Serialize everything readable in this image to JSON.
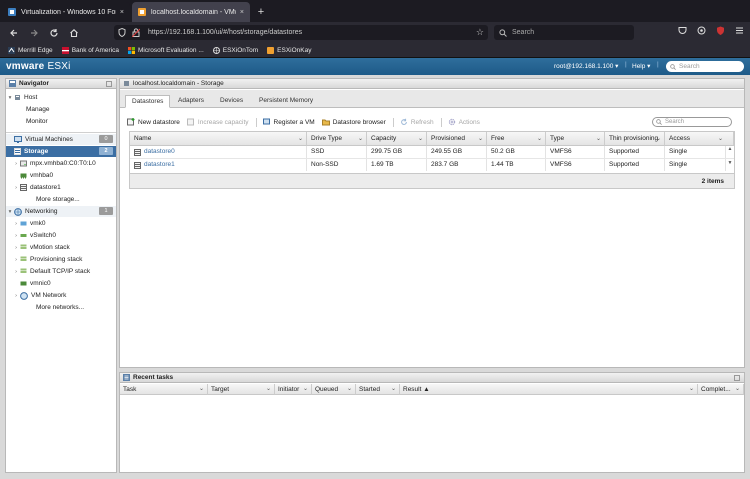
{
  "browser": {
    "tabs": [
      {
        "title": "Virtualization - Windows 10 For",
        "close": "×",
        "active": false
      },
      {
        "title": "localhost.localdomain - VMwa",
        "close": "×",
        "active": true
      }
    ],
    "new_tab": "+",
    "url": "https://192.168.1.100/ui/#/host/storage/datastores",
    "search_placeholder": "Search",
    "bookmarks": [
      "Merrill Edge",
      "Bank of America",
      "Microsoft Evaluation ...",
      "ESXiOnTom",
      "ESXiOnKay"
    ]
  },
  "esxi": {
    "brand": "vmware",
    "product": "ESXi",
    "user": "root@192.168.1.100 ▾",
    "help": "Help ▾",
    "search_placeholder": "Search"
  },
  "navigator": {
    "title": "Navigator",
    "host": {
      "label": "Host",
      "children": [
        "Manage",
        "Monitor"
      ]
    },
    "vms": {
      "label": "Virtual Machines",
      "count": "0"
    },
    "storage": {
      "label": "Storage",
      "count": "2",
      "children": [
        "mpx.vmhba0:C0:T0:L0",
        "vmhba0",
        "datastore1",
        "More storage..."
      ]
    },
    "networking": {
      "label": "Networking",
      "count": "1",
      "children": [
        "vmk0",
        "vSwitch0",
        "vMotion stack",
        "Provisioning stack",
        "Default TCP/IP stack",
        "vmnic0",
        "VM Network",
        "More networks..."
      ]
    }
  },
  "main": {
    "title": "localhost.localdomain - Storage",
    "tabs": [
      "Datastores",
      "Adapters",
      "Devices",
      "Persistent Memory"
    ],
    "toolbar": {
      "new_datastore": "New datastore",
      "increase_capacity": "Increase capacity",
      "register_vm": "Register a VM",
      "datastore_browser": "Datastore browser",
      "refresh": "Refresh",
      "actions": "Actions"
    },
    "search_placeholder": "Search",
    "columns": [
      "Name",
      "Drive Type",
      "Capacity",
      "Provisioned",
      "Free",
      "Type",
      "Thin provisioning",
      "Access"
    ],
    "rows": [
      [
        "datastore0",
        "SSD",
        "299.75 GB",
        "249.55 GB",
        "50.2 GB",
        "VMFS6",
        "Supported",
        "Single"
      ],
      [
        "datastore1",
        "Non-SSD",
        "1.69 TB",
        "283.7 GB",
        "1.44 TB",
        "VMFS6",
        "Supported",
        "Single"
      ]
    ],
    "footer": "2 items"
  },
  "recent_tasks": {
    "title": "Recent tasks",
    "columns": [
      "Task",
      "Target",
      "Initiator",
      "Queued",
      "Started",
      "Result ▲",
      "Complet..."
    ]
  }
}
